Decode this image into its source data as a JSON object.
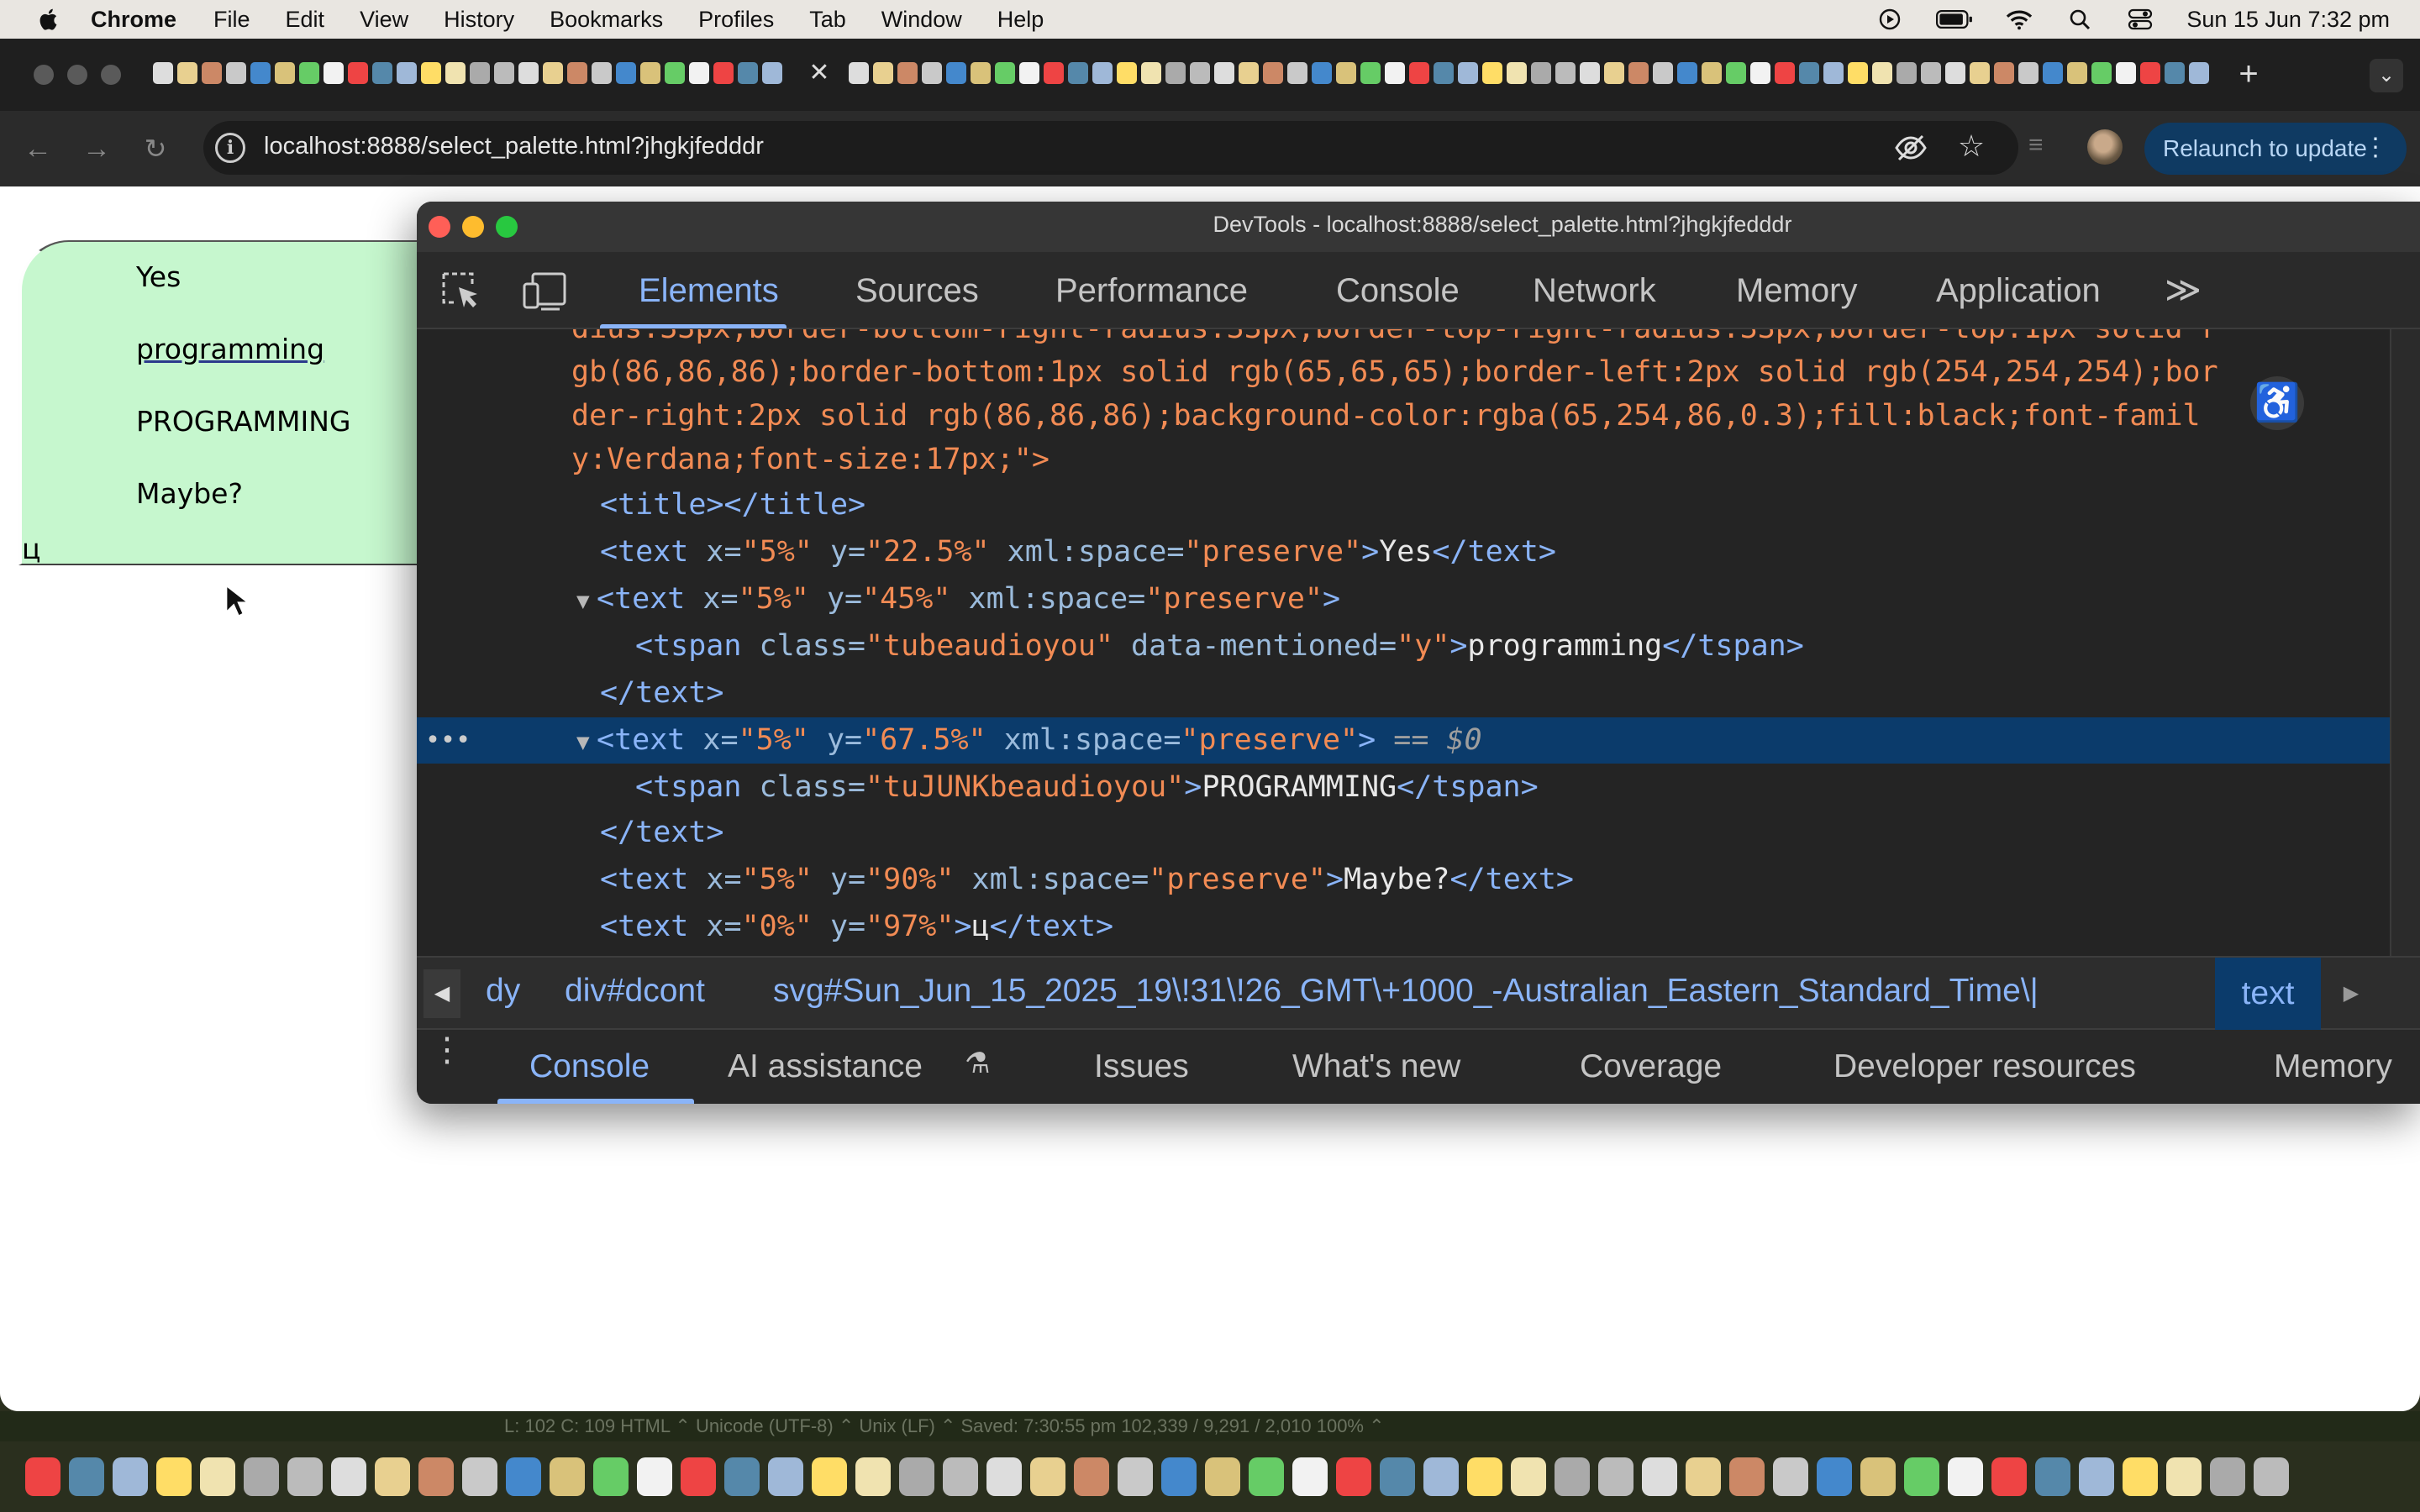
{
  "menubar": {
    "app": "Chrome",
    "items": [
      "File",
      "Edit",
      "View",
      "History",
      "Bookmarks",
      "Profiles",
      "Tab",
      "Window",
      "Help"
    ],
    "clock": "Sun 15 Jun  7:32 pm",
    "status_icons": [
      "play-circle-icon",
      "battery-icon",
      "wifi-icon",
      "search-icon",
      "control-center-icon"
    ]
  },
  "browser": {
    "url": "localhost:8888/select_palette.html?jhgkjfedddr",
    "relaunch_label": "Relaunch to update"
  },
  "page": {
    "options": [
      "Yes",
      "programming",
      "PROGRAMMING",
      "Maybe?"
    ],
    "glyph": "ц",
    "background_color": "#c6f7ce"
  },
  "devtools": {
    "title": "DevTools - localhost:8888/select_palette.html?jhgkjfedddr",
    "tabs": [
      "Elements",
      "Sources",
      "Performance",
      "Console",
      "Network",
      "Memory",
      "Application"
    ],
    "more_tabs": "≫",
    "style_lines": [
      "dius:33px;border-bottom-right-radius:33px;border-top-right-radius:33px;border-top:1px solid r",
      "gb(86,86,86);border-bottom:1px solid rgb(65,65,65);border-left:2px solid rgb(254,254,254);bor",
      "der-right:2px solid rgb(86,86,86);background-color:rgba(65,254,86,0.3);fill:black;font-famil",
      "y:Verdana;font-size:17px;\">"
    ],
    "nodes": {
      "title_open": "<title>",
      "title_close": "</title>",
      "text_open": "<text",
      "text_close": "</text>",
      "tspan_open": "<tspan",
      "tspan_close": "</tspan>",
      "close_bracket": ">",
      "attr_x": " x=",
      "attr_y": " y=",
      "attr_space": " xml:space=",
      "attr_class": " class=",
      "attr_mentioned": " data-mentioned=",
      "val_preserve": "\"preserve\"",
      "val_5": "\"5%\"",
      "val_0": "\"0%\"",
      "val_225": "\"22.5%\"",
      "val_45": "\"45%\"",
      "val_675": "\"67.5%\"",
      "val_90": "\"90%\"",
      "val_97": "\"97%\"",
      "val_class1": "\"tubeaudioyou\"",
      "val_class2": "\"tuJUNKbeaudioyou\"",
      "val_y": "\"y\"",
      "text_yes": "Yes",
      "text_programming": "programming",
      "text_upper": "PROGRAMMING",
      "text_maybe": "Maybe?",
      "text_glyph": "ц",
      "selected_marker": " == $0",
      "ellipsis": "•••"
    },
    "breadcrumb": {
      "items": [
        "dy",
        "div#dcont",
        "svg#Sun_Jun_15_2025_19\\!31\\!26_GMT\\+1000_-Australian_Eastern_Standard_Time\\|"
      ],
      "selected": "text"
    },
    "drawer_tabs": [
      "Console",
      "AI assistance",
      "Issues",
      "What's new",
      "Coverage",
      "Developer resources",
      "Memory"
    ]
  },
  "background_strip": "L: 102 C: 109     HTML ⌃    Unicode (UTF-8) ⌃    Unix (LF) ⌃    Saved: 7:30:55 pm    102,339 / 9,291 / 2,010    100% ⌃"
}
